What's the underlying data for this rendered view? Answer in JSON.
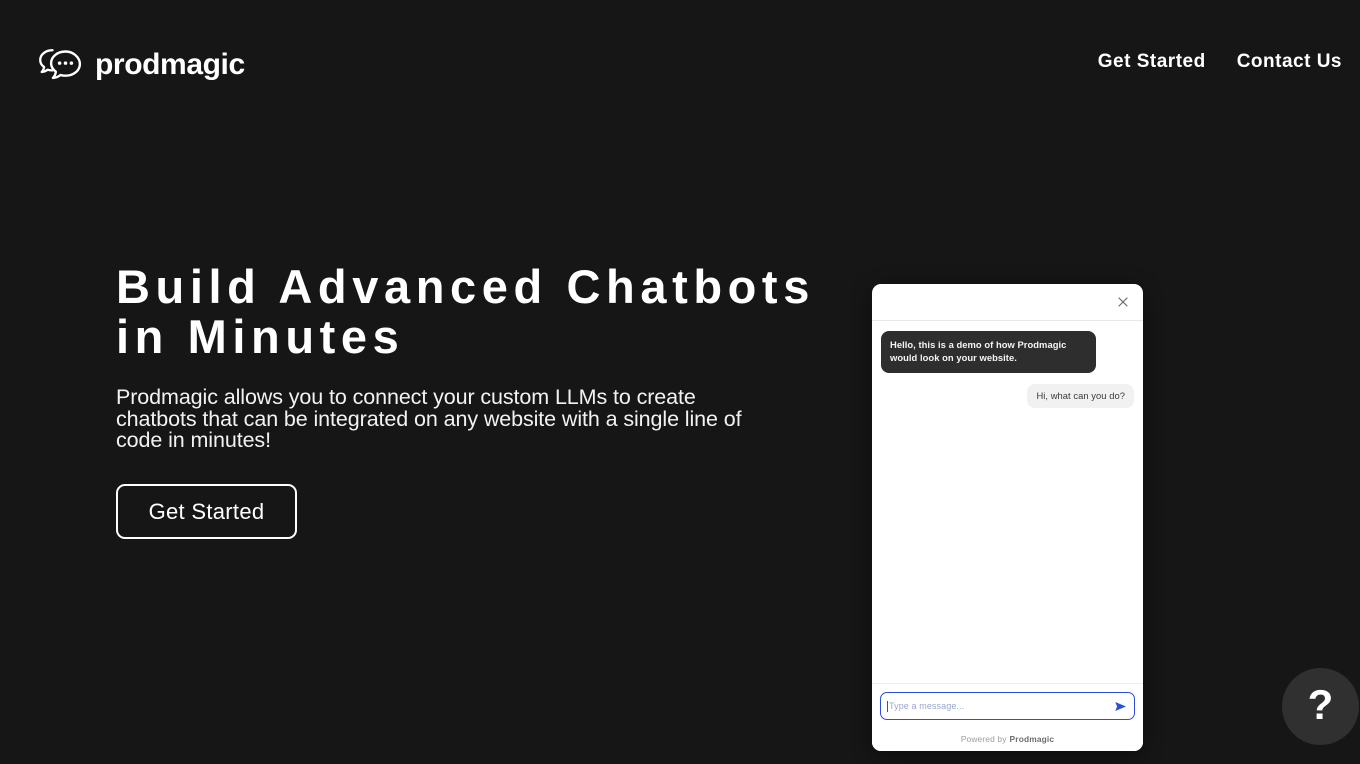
{
  "page": {
    "background_color": "#161616"
  },
  "header": {
    "brand": {
      "name": "prodmagic",
      "logo_icon": "chat-bubbles-icon"
    },
    "nav": [
      {
        "label": "Get Started"
      },
      {
        "label": "Contact Us"
      }
    ]
  },
  "hero": {
    "title": "Build Advanced Chatbots\nin Minutes",
    "subtitle": "Prodmagic allows you to connect your custom LLMs to create chatbots that can be integrated on any website with a single line of code in minutes!",
    "cta_label": "Get Started"
  },
  "chat_widget": {
    "close_icon": "close-icon",
    "messages": [
      {
        "sender": "bot",
        "text": "Hello, this is a demo of how Prodmagic would look on your website."
      },
      {
        "sender": "user",
        "text": "Hi, what can you do?"
      }
    ],
    "input": {
      "value": "",
      "placeholder": "Type a message...",
      "send_icon": "send-arrow-icon",
      "focus_color": "#2b4fd8"
    },
    "footer": {
      "prefix": "Powered by",
      "brand": "Prodmagic"
    }
  },
  "help_button": {
    "label": "?",
    "icon": "question-mark-icon",
    "color": "#303030"
  }
}
